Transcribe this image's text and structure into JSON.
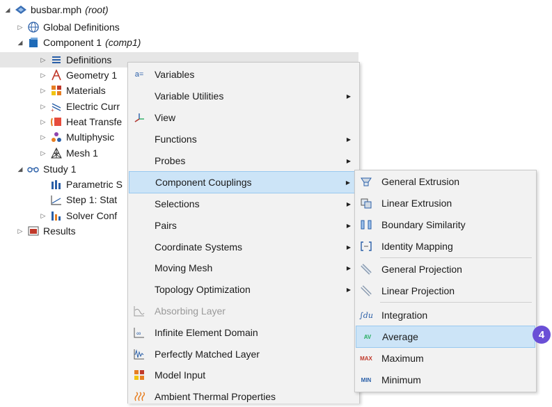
{
  "tree": {
    "root": {
      "label": "busbar.mph",
      "tag": "(root)"
    },
    "items": [
      {
        "label": "Global Definitions"
      },
      {
        "label": "Component 1",
        "tag": "(comp1)"
      },
      {
        "label": "Definitions"
      },
      {
        "label": "Geometry 1"
      },
      {
        "label": "Materials"
      },
      {
        "label": "Electric Curr"
      },
      {
        "label": "Heat Transfe"
      },
      {
        "label": "Multiphysic"
      },
      {
        "label": "Mesh 1"
      },
      {
        "label": "Study 1"
      },
      {
        "label": "Parametric S"
      },
      {
        "label": "Step 1: Stat"
      },
      {
        "label": "Solver Conf"
      },
      {
        "label": "Results"
      }
    ]
  },
  "context_menu": {
    "items": [
      {
        "label": "Variables",
        "icon": "a="
      },
      {
        "label": "Variable Utilities"
      },
      {
        "label": "View"
      },
      {
        "label": "Functions"
      },
      {
        "label": "Probes"
      },
      {
        "label": "Component Couplings"
      },
      {
        "label": "Selections"
      },
      {
        "label": "Pairs"
      },
      {
        "label": "Coordinate Systems"
      },
      {
        "label": "Moving Mesh"
      },
      {
        "label": "Topology Optimization"
      },
      {
        "label": "Absorbing Layer"
      },
      {
        "label": "Infinite Element Domain"
      },
      {
        "label": "Perfectly Matched Layer"
      },
      {
        "label": "Model Input"
      },
      {
        "label": "Ambient Thermal Properties"
      }
    ]
  },
  "submenu": {
    "items": [
      {
        "label": "General Extrusion"
      },
      {
        "label": "Linear Extrusion"
      },
      {
        "label": "Boundary Similarity"
      },
      {
        "label": "Identity Mapping"
      },
      {
        "label": "General Projection"
      },
      {
        "label": "Linear Projection"
      },
      {
        "label": "Integration",
        "icon": "∫du"
      },
      {
        "label": "Average",
        "icon": "AV"
      },
      {
        "label": "Maximum",
        "icon": "MAX"
      },
      {
        "label": "Minimum",
        "icon": "MIN"
      }
    ]
  },
  "callout": {
    "number": "4"
  },
  "colors": {
    "highlight": "#cce4f7",
    "badge": "#6a4fd6",
    "selected_row": "#e6e6e6"
  }
}
